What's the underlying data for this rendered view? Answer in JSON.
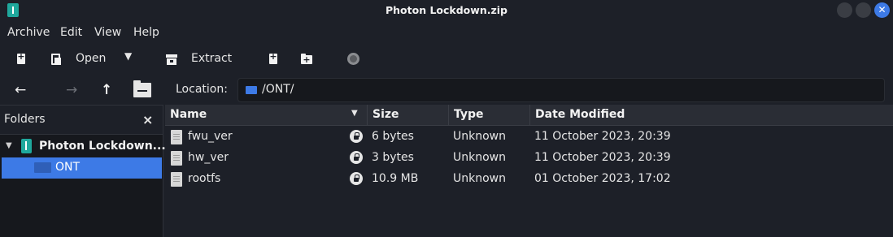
{
  "window": {
    "title": "Photon Lockdown.zip"
  },
  "menu": [
    "Archive",
    "Edit",
    "View",
    "Help"
  ],
  "toolbar": {
    "open_label": "Open",
    "extract_label": "Extract"
  },
  "location": {
    "label": "Location:",
    "value": "/ONT/"
  },
  "sidebar": {
    "title": "Folders",
    "close": "×",
    "root": "Photon Lockdown....",
    "child": "ONT"
  },
  "columns": {
    "name": "Name",
    "size": "Size",
    "type": "Type",
    "modified": "Date Modified"
  },
  "files": [
    {
      "name": "fwu_ver",
      "size": "6 bytes",
      "type": "Unknown",
      "modified": "11 October 2023, 20:39"
    },
    {
      "name": "hw_ver",
      "size": "3 bytes",
      "type": "Unknown",
      "modified": "11 October 2023, 20:39"
    },
    {
      "name": "rootfs",
      "size": "10.9 MB",
      "type": "Unknown",
      "modified": "01 October 2023, 17:02"
    }
  ],
  "colors": {
    "accent": "#3d7ae6",
    "background": "#1d2028",
    "sidebar": "#16181d"
  }
}
